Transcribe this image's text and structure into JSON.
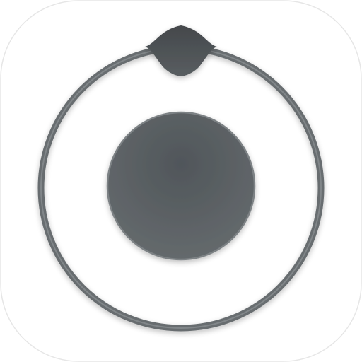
{
  "app_icon": {
    "icon_name": "orbit-app-icon",
    "elements": {
      "ring": "ring-icon",
      "orbiting_knob": "knob-icon",
      "center_disc": "center-disc-icon"
    },
    "colors": {
      "tile_background": "#ffffff",
      "tile_border": "#e6e6e6",
      "ring_stroke": "#686d70",
      "ring_highlight": "#8c9194",
      "knob_fill": "#4e5356",
      "disc_fill_top": "#50565a",
      "disc_fill_bottom": "#666b6e",
      "disc_rim": "#7d8285"
    }
  }
}
